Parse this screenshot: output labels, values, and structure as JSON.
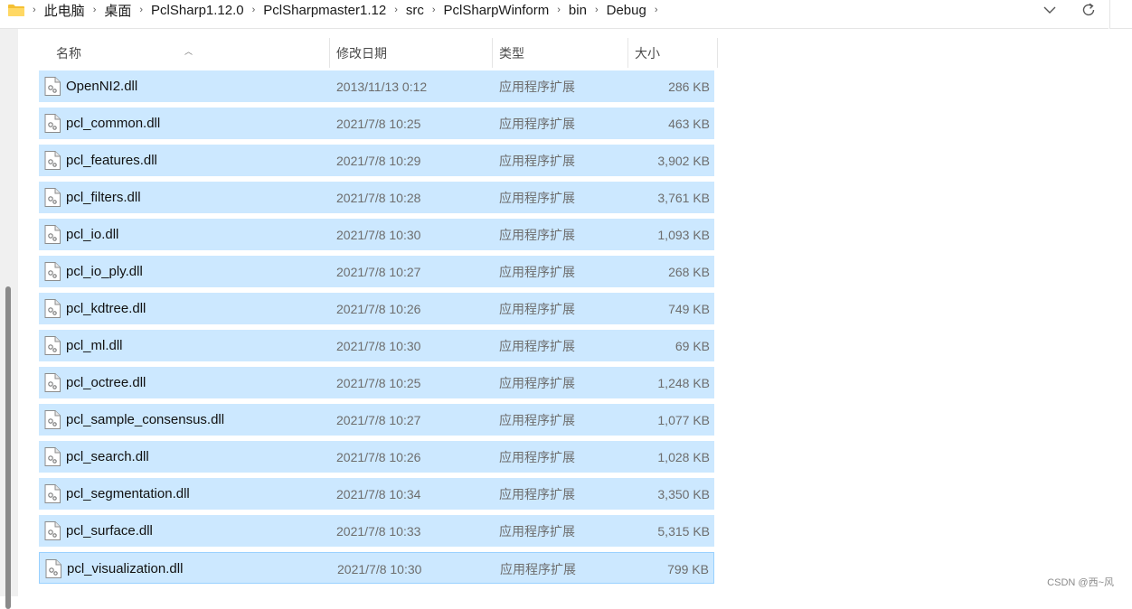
{
  "breadcrumb": [
    "此电脑",
    "桌面",
    "PclSharp1.12.0",
    "PclSharpmaster1.12",
    "src",
    "PclSharpWinform",
    "bin",
    "Debug"
  ],
  "columns": {
    "name": "名称",
    "date": "修改日期",
    "type": "类型",
    "size": "大小"
  },
  "files": [
    {
      "name": "OpenNI2.dll",
      "date": "2013/11/13 0:12",
      "type": "应用程序扩展",
      "size": "286 KB"
    },
    {
      "name": "pcl_common.dll",
      "date": "2021/7/8 10:25",
      "type": "应用程序扩展",
      "size": "463 KB"
    },
    {
      "name": "pcl_features.dll",
      "date": "2021/7/8 10:29",
      "type": "应用程序扩展",
      "size": "3,902 KB"
    },
    {
      "name": "pcl_filters.dll",
      "date": "2021/7/8 10:28",
      "type": "应用程序扩展",
      "size": "3,761 KB"
    },
    {
      "name": "pcl_io.dll",
      "date": "2021/7/8 10:30",
      "type": "应用程序扩展",
      "size": "1,093 KB"
    },
    {
      "name": "pcl_io_ply.dll",
      "date": "2021/7/8 10:27",
      "type": "应用程序扩展",
      "size": "268 KB"
    },
    {
      "name": "pcl_kdtree.dll",
      "date": "2021/7/8 10:26",
      "type": "应用程序扩展",
      "size": "749 KB"
    },
    {
      "name": "pcl_ml.dll",
      "date": "2021/7/8 10:30",
      "type": "应用程序扩展",
      "size": "69 KB"
    },
    {
      "name": "pcl_octree.dll",
      "date": "2021/7/8 10:25",
      "type": "应用程序扩展",
      "size": "1,248 KB"
    },
    {
      "name": "pcl_sample_consensus.dll",
      "date": "2021/7/8 10:27",
      "type": "应用程序扩展",
      "size": "1,077 KB"
    },
    {
      "name": "pcl_search.dll",
      "date": "2021/7/8 10:26",
      "type": "应用程序扩展",
      "size": "1,028 KB"
    },
    {
      "name": "pcl_segmentation.dll",
      "date": "2021/7/8 10:34",
      "type": "应用程序扩展",
      "size": "3,350 KB"
    },
    {
      "name": "pcl_surface.dll",
      "date": "2021/7/8 10:33",
      "type": "应用程序扩展",
      "size": "5,315 KB"
    },
    {
      "name": "pcl_visualization.dll",
      "date": "2021/7/8 10:30",
      "type": "应用程序扩展",
      "size": "799 KB"
    }
  ],
  "watermark": "CSDN @西~风",
  "icons": {
    "folder": "folder-icon",
    "file": "dll-file-icon",
    "dropdown": "chevron-down-icon",
    "refresh": "refresh-icon"
  },
  "colors": {
    "selection": "#cce8ff",
    "focus_border": "#99d1ff",
    "folder": "#f5c033"
  }
}
